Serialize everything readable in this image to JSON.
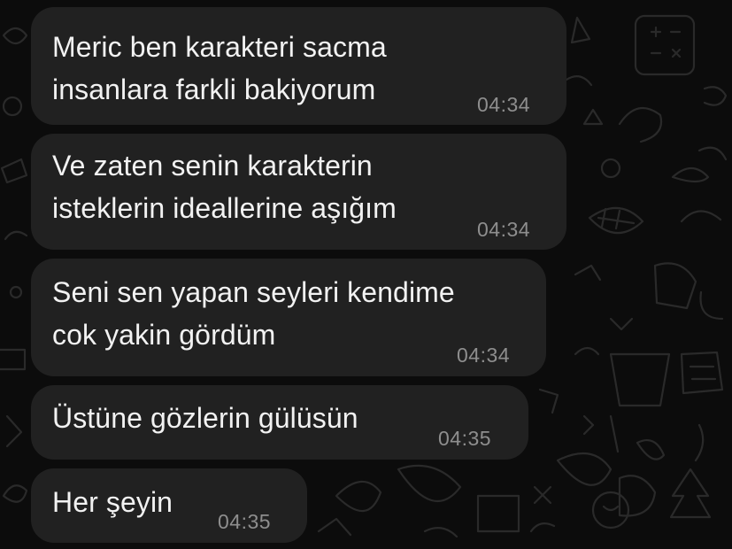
{
  "conversation": {
    "messages": [
      {
        "text": "Meric ben karakteri sacma\ninsanlara farkli bakiyorum",
        "time": "04:34"
      },
      {
        "text": "Ve zaten senin karakterin\nisteklerin ideallerine aşığım",
        "time": "04:34"
      },
      {
        "text": "Seni sen yapan seyleri kendime\ncok yakin gördüm",
        "time": "04:34"
      },
      {
        "text": "Üstüne gözlerin gülüsün",
        "time": "04:35"
      },
      {
        "text": "Her şeyin",
        "time": "04:35"
      }
    ]
  },
  "colors": {
    "background": "#0c0c0c",
    "bubble": "#212121",
    "message_text": "#f2f2f2",
    "timestamp": "#8e8e8e"
  }
}
